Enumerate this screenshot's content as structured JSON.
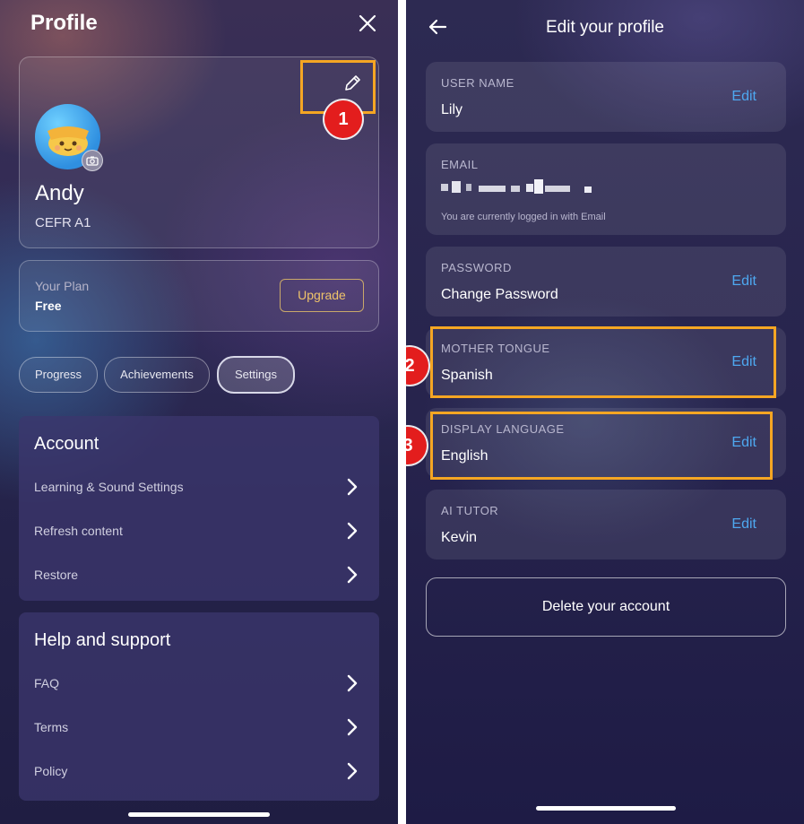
{
  "left_screen": {
    "title": "Profile",
    "close_icon": "close-icon",
    "profile_card": {
      "edit_icon": "pencil-icon",
      "name": "Andy",
      "level": "CEFR A1",
      "avatar_icon": "avatar-icon",
      "camera_icon": "camera-icon"
    },
    "plan": {
      "label": "Your Plan",
      "value": "Free",
      "upgrade_label": "Upgrade"
    },
    "tabs": [
      {
        "label": "Progress"
      },
      {
        "label": "Achievements"
      },
      {
        "label": "Settings",
        "active": true
      }
    ],
    "account": {
      "heading": "Account",
      "items": [
        {
          "label": "Learning & Sound Settings"
        },
        {
          "label": "Refresh content"
        },
        {
          "label": "Restore"
        }
      ]
    },
    "help": {
      "heading": "Help and support",
      "items": [
        {
          "label": "FAQ"
        },
        {
          "label": "Terms"
        },
        {
          "label": "Policy"
        }
      ]
    }
  },
  "right_screen": {
    "title": "Edit your profile",
    "back_icon": "arrow-left-icon",
    "fields": [
      {
        "label": "USER NAME",
        "value": "Lily",
        "action": "Edit"
      },
      {
        "label": "EMAIL",
        "value": "",
        "note": "You are currently logged in with Email"
      },
      {
        "label": "PASSWORD",
        "value": "Change Password",
        "action": "Edit"
      },
      {
        "label": "MOTHER TONGUE",
        "value": "Spanish",
        "action": "Edit"
      },
      {
        "label": "DISPLAY LANGUAGE",
        "value": "English",
        "action": "Edit"
      },
      {
        "label": "AI TUTOR",
        "value": "Kevin",
        "action": "Edit"
      }
    ],
    "delete_label": "Delete your account"
  },
  "annotations": {
    "step1": "1",
    "step2": "2",
    "step3": "3",
    "highlight_color": "#f5a623",
    "badge_color": "#e31d1d"
  },
  "colors": {
    "edit_link": "#4ea8f0",
    "upgrade_text": "#f0c46a"
  }
}
